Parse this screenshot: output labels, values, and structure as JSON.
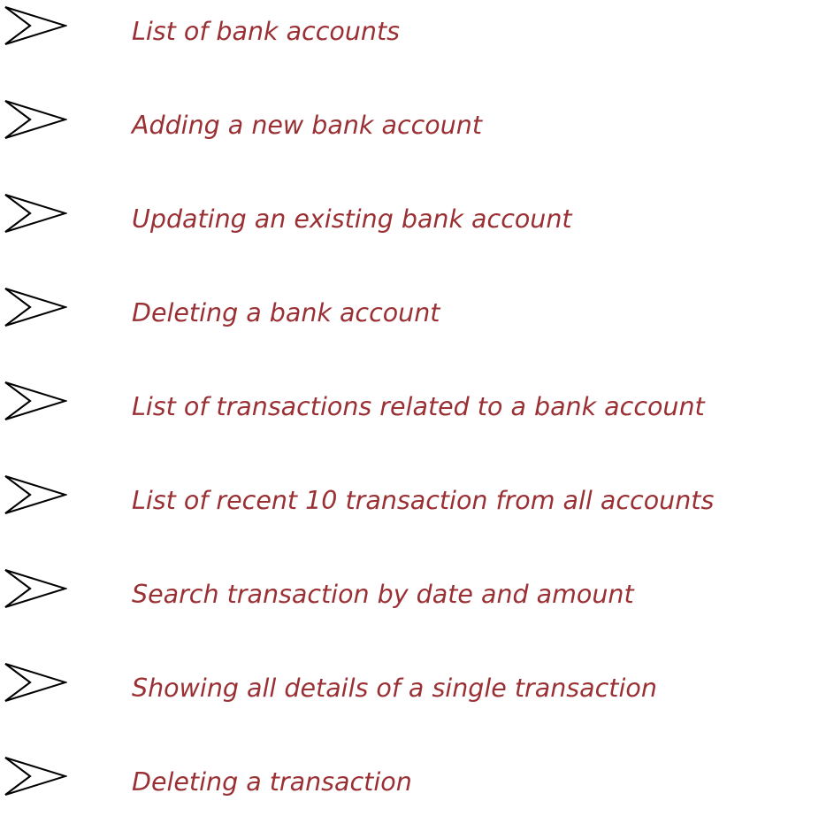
{
  "colors": {
    "text": "#9a3034",
    "bullet": "#000000",
    "background": "#ffffff"
  },
  "bullet_icon": "arrowhead-bullet-icon",
  "items": [
    {
      "label": "List of bank accounts"
    },
    {
      "label": "Adding a new bank account"
    },
    {
      "label": "Updating an existing bank account"
    },
    {
      "label": "Deleting a bank account"
    },
    {
      "label": "List of transactions related to a bank account"
    },
    {
      "label": "List of recent 10 transaction from all accounts"
    },
    {
      "label": "Search transaction by date and amount"
    },
    {
      "label": "Showing all details of a single transaction"
    },
    {
      "label": "Deleting a transaction"
    }
  ]
}
